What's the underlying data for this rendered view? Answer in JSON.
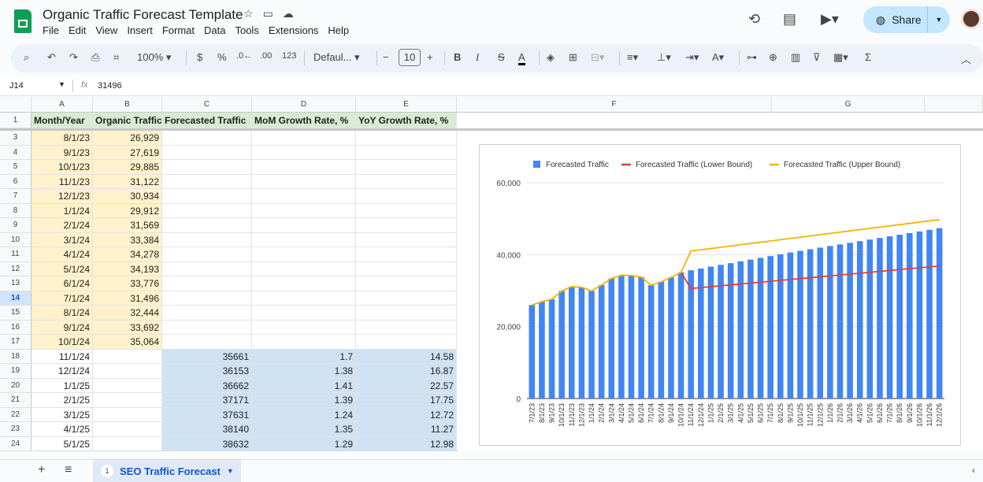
{
  "app": {
    "title": "Organic Traffic Forecast Template",
    "menus": [
      "File",
      "Edit",
      "View",
      "Insert",
      "Format",
      "Data",
      "Tools",
      "Extensions",
      "Help"
    ],
    "share_label": "Share"
  },
  "toolbar": {
    "zoom": "100%",
    "currency": "$",
    "percent": "%",
    "dec_dec": ".0←",
    "dec_inc": ".00",
    "number_fmt": "123",
    "font": "Defaul...",
    "font_size": "10",
    "minus": "−",
    "plus": "+"
  },
  "formula": {
    "cell_ref": "J14",
    "fx": "fx",
    "value": "31496"
  },
  "columns": [
    "A",
    "B",
    "C",
    "D",
    "E",
    "F",
    "G"
  ],
  "headers": [
    "Month/Year",
    "Organic Traffic",
    "Forecasted Traffic",
    "MoM Growth Rate, %",
    "YoY Growth Rate, %"
  ],
  "rows": [
    {
      "n": "3",
      "a": "8/1/23",
      "b": "26,929",
      "c": "",
      "d": "",
      "e": ""
    },
    {
      "n": "4",
      "a": "9/1/23",
      "b": "27,619",
      "c": "",
      "d": "",
      "e": ""
    },
    {
      "n": "5",
      "a": "10/1/23",
      "b": "29,885",
      "c": "",
      "d": "",
      "e": ""
    },
    {
      "n": "6",
      "a": "11/1/23",
      "b": "31,122",
      "c": "",
      "d": "",
      "e": ""
    },
    {
      "n": "7",
      "a": "12/1/23",
      "b": "30,934",
      "c": "",
      "d": "",
      "e": ""
    },
    {
      "n": "8",
      "a": "1/1/24",
      "b": "29,912",
      "c": "",
      "d": "",
      "e": ""
    },
    {
      "n": "9",
      "a": "2/1/24",
      "b": "31,569",
      "c": "",
      "d": "",
      "e": ""
    },
    {
      "n": "10",
      "a": "3/1/24",
      "b": "33,384",
      "c": "",
      "d": "",
      "e": ""
    },
    {
      "n": "11",
      "a": "4/1/24",
      "b": "34,278",
      "c": "",
      "d": "",
      "e": ""
    },
    {
      "n": "12",
      "a": "5/1/24",
      "b": "34,193",
      "c": "",
      "d": "",
      "e": ""
    },
    {
      "n": "13",
      "a": "6/1/24",
      "b": "33,776",
      "c": "",
      "d": "",
      "e": ""
    },
    {
      "n": "14",
      "a": "7/1/24",
      "b": "31,496",
      "c": "",
      "d": "",
      "e": ""
    },
    {
      "n": "15",
      "a": "8/1/24",
      "b": "32,444",
      "c": "",
      "d": "",
      "e": ""
    },
    {
      "n": "16",
      "a": "9/1/24",
      "b": "33,692",
      "c": "",
      "d": "",
      "e": ""
    },
    {
      "n": "17",
      "a": "10/1/24",
      "b": "35,064",
      "c": "",
      "d": "",
      "e": ""
    },
    {
      "n": "18",
      "a": "11/1/24",
      "b": "",
      "c": "35661",
      "d": "1.7",
      "e": "14.58"
    },
    {
      "n": "19",
      "a": "12/1/24",
      "b": "",
      "c": "36153",
      "d": "1.38",
      "e": "16.87"
    },
    {
      "n": "20",
      "a": "1/1/25",
      "b": "",
      "c": "36662",
      "d": "1.41",
      "e": "22.57"
    },
    {
      "n": "21",
      "a": "2/1/25",
      "b": "",
      "c": "37171",
      "d": "1.39",
      "e": "17.75"
    },
    {
      "n": "22",
      "a": "3/1/25",
      "b": "",
      "c": "37631",
      "d": "1.24",
      "e": "12.72"
    },
    {
      "n": "23",
      "a": "4/1/25",
      "b": "",
      "c": "38140",
      "d": "1.35",
      "e": "11.27"
    },
    {
      "n": "24",
      "a": "5/1/25",
      "b": "",
      "c": "38632",
      "d": "1.29",
      "e": "12.98"
    }
  ],
  "sheet": {
    "tab_number": "1",
    "tab_name": "SEO Traffic Forecast"
  },
  "chart_data": {
    "type": "bar",
    "categories": [
      "7/1/23",
      "8/1/23",
      "9/1/23",
      "10/1/23",
      "11/1/23",
      "12/1/23",
      "1/1/24",
      "2/1/24",
      "3/1/24",
      "4/1/24",
      "5/1/24",
      "6/1/24",
      "7/1/24",
      "8/1/24",
      "9/1/24",
      "10/1/24",
      "11/1/24",
      "12/1/24",
      "1/1/25",
      "2/1/25",
      "3/1/25",
      "4/1/25",
      "5/1/25",
      "6/1/25",
      "7/1/25",
      "8/1/25",
      "9/1/25",
      "10/1/25",
      "11/1/25",
      "12/1/25",
      "1/1/26",
      "2/1/26",
      "3/1/26",
      "4/1/26",
      "5/1/26",
      "6/1/26",
      "7/1/26",
      "8/1/26",
      "9/1/26",
      "10/1/26",
      "11/1/26",
      "12/1/26"
    ],
    "series": [
      {
        "name": "Forecasted Traffic",
        "color": "#4285f4",
        "values": [
          26000,
          26929,
          27619,
          29885,
          31122,
          30934,
          29912,
          31569,
          33384,
          34278,
          34193,
          33776,
          31496,
          32444,
          33692,
          35064,
          35661,
          36153,
          36662,
          37171,
          37631,
          38140,
          38632,
          39100,
          39600,
          40100,
          40600,
          41050,
          41500,
          41950,
          42400,
          42850,
          43300,
          43750,
          44200,
          44650,
          45100,
          45550,
          46000,
          46450,
          46900,
          47350
        ]
      },
      {
        "name": "Forecasted Traffic (Lower Bound)",
        "color": "#db4437",
        "values": [
          null,
          null,
          null,
          null,
          null,
          null,
          null,
          null,
          null,
          null,
          null,
          null,
          null,
          null,
          null,
          35064,
          30600,
          30850,
          31100,
          31350,
          31600,
          31850,
          32100,
          32350,
          32600,
          32850,
          33100,
          33350,
          33600,
          33850,
          34100,
          34350,
          34600,
          34850,
          35100,
          35350,
          35600,
          35850,
          36100,
          36350,
          36600,
          36850
        ]
      },
      {
        "name": "Forecasted Traffic (Upper Bound)",
        "color": "#f4b400",
        "values": [
          26000,
          26929,
          27619,
          29885,
          31122,
          30934,
          29912,
          31569,
          33384,
          34278,
          34193,
          33776,
          31496,
          32444,
          33692,
          35064,
          41000,
          41350,
          41700,
          42050,
          42400,
          42750,
          43100,
          43450,
          43800,
          44150,
          44500,
          44850,
          45200,
          45550,
          45900,
          46250,
          46600,
          46950,
          47300,
          47650,
          48000,
          48350,
          48700,
          49050,
          49400,
          49750
        ]
      }
    ],
    "yticks": [
      "0",
      "20,000",
      "40,000",
      "60,000"
    ],
    "ylim": [
      0,
      60000
    ],
    "legend": "top"
  }
}
